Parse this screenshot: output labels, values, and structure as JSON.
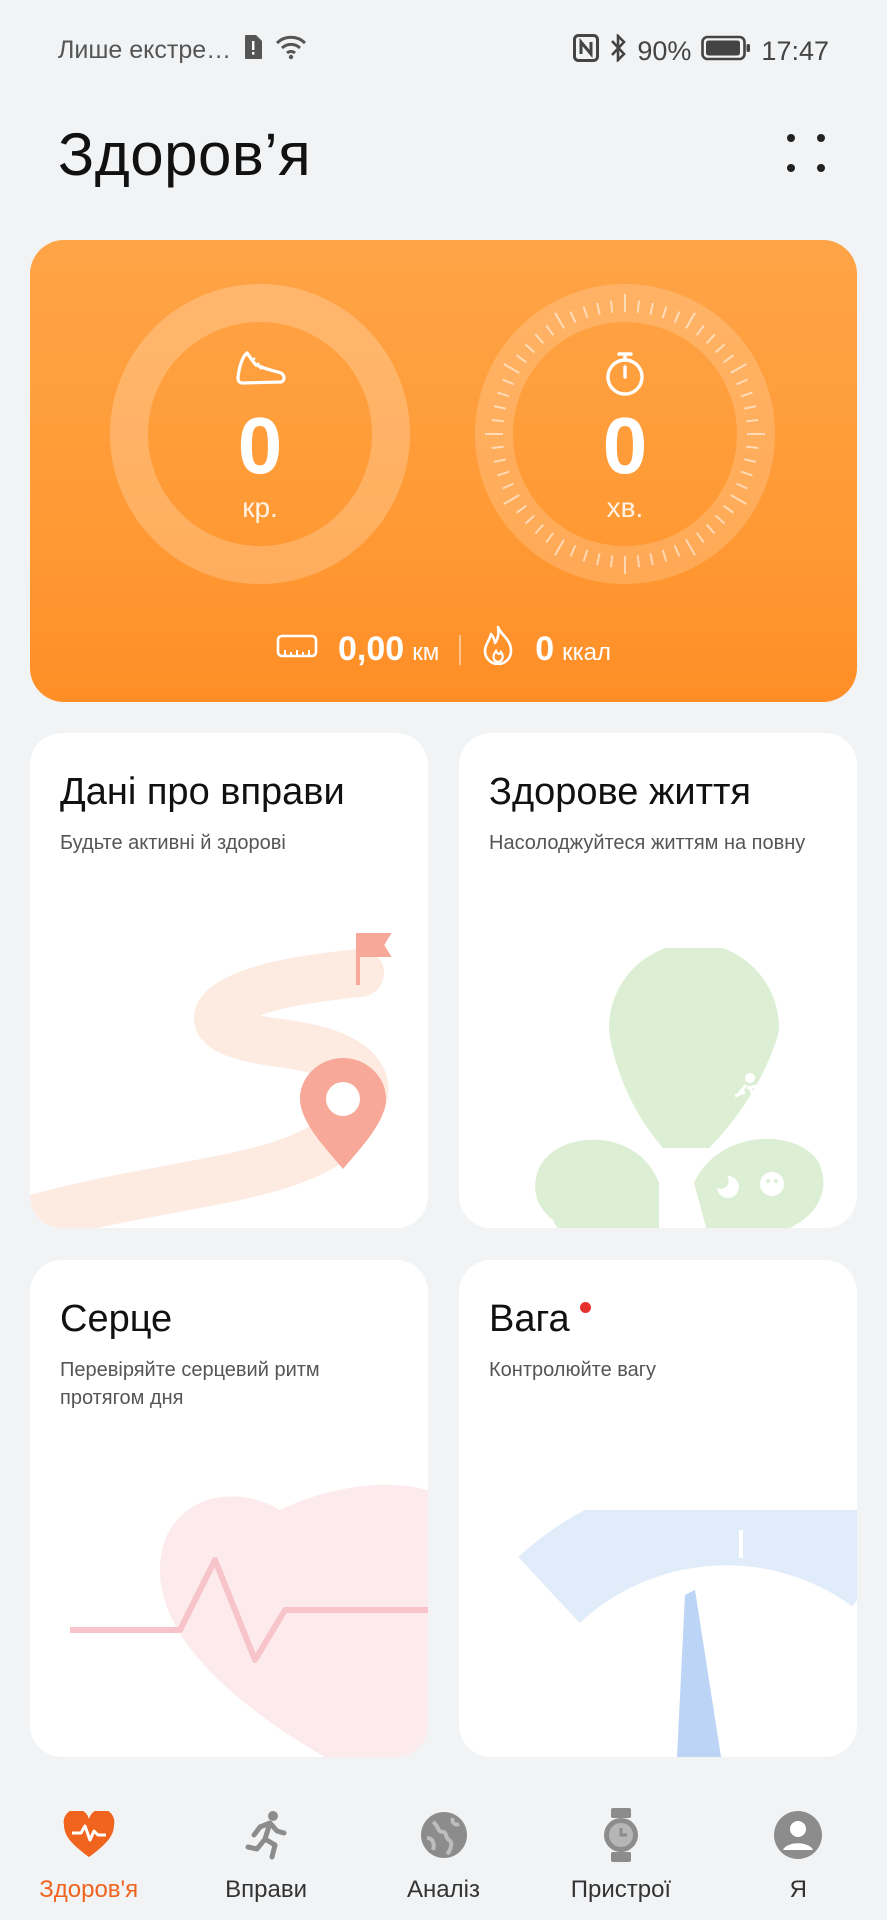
{
  "status_bar": {
    "carrier_text": "Лише екстре…",
    "battery_percent": "90%",
    "time": "17:47",
    "icons": [
      "sim-alert-icon",
      "wifi-icon",
      "nfc-icon",
      "bluetooth-icon",
      "battery-icon"
    ]
  },
  "header": {
    "title": "Здоров’я",
    "menu_icon": "grid-dots-icon"
  },
  "activity": {
    "steps": {
      "value": "0",
      "unit": "кр.",
      "icon": "sneaker-icon"
    },
    "minutes": {
      "value": "0",
      "unit": "хв.",
      "icon": "stopwatch-icon"
    },
    "distance": {
      "value": "0,00",
      "unit": "км",
      "icon": "ruler-icon"
    },
    "calories": {
      "value": "0",
      "unit": "ккал",
      "icon": "flame-icon"
    },
    "colors": {
      "card_top": "#ffa447",
      "card_bottom": "#ff8e26"
    }
  },
  "cards": {
    "exercise": {
      "title": "Дані про вправи",
      "subtitle": "Будьте активні й здорові"
    },
    "healthy_living": {
      "title": "Здорове життя",
      "subtitle": "Насолоджуйтеся життям на повну"
    },
    "heart": {
      "title": "Серце",
      "subtitle": "Перевіряйте серцевий ритм протягом дня"
    },
    "weight": {
      "title": "Вага",
      "subtitle": "Контролюйте вагу",
      "has_notification": true
    }
  },
  "bottom_nav": {
    "active_color": "#f0641e",
    "items": [
      {
        "label": "Здоров'я",
        "icon": "heart-pulse-icon",
        "active": true
      },
      {
        "label": "Вправи",
        "icon": "running-icon",
        "active": false
      },
      {
        "label": "Аналіз",
        "icon": "globe-icon",
        "active": false
      },
      {
        "label": "Пристрої",
        "icon": "watch-icon",
        "active": false
      },
      {
        "label": "Я",
        "icon": "profile-icon",
        "active": false
      }
    ]
  }
}
